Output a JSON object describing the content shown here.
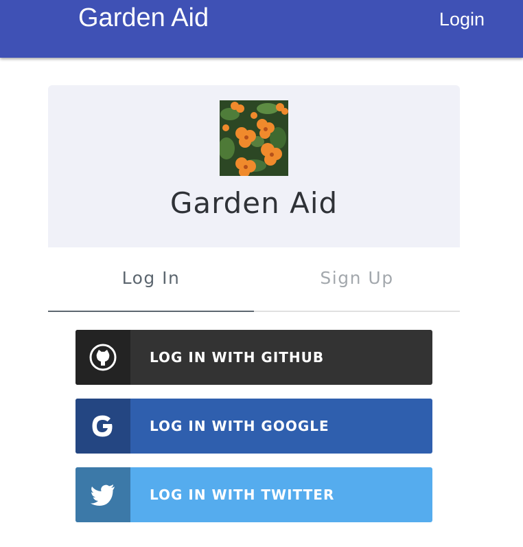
{
  "appbar": {
    "title": "Garden Aid",
    "login_label": "Login",
    "color": "#3f51b5"
  },
  "card": {
    "logo_icon": "pansy-flowers-image",
    "title": "Garden Aid",
    "tabs": [
      {
        "label": "Log In",
        "active": true
      },
      {
        "label": "Sign Up",
        "active": false
      }
    ]
  },
  "social": [
    {
      "label": "LOG IN WITH GITHUB",
      "icon": "github-icon",
      "color": "#333333"
    },
    {
      "label": "LOG IN WITH GOOGLE",
      "icon": "google-icon",
      "color": "#2f5fae"
    },
    {
      "label": "LOG IN WITH TWITTER",
      "icon": "twitter-icon",
      "color": "#55acee"
    }
  ]
}
